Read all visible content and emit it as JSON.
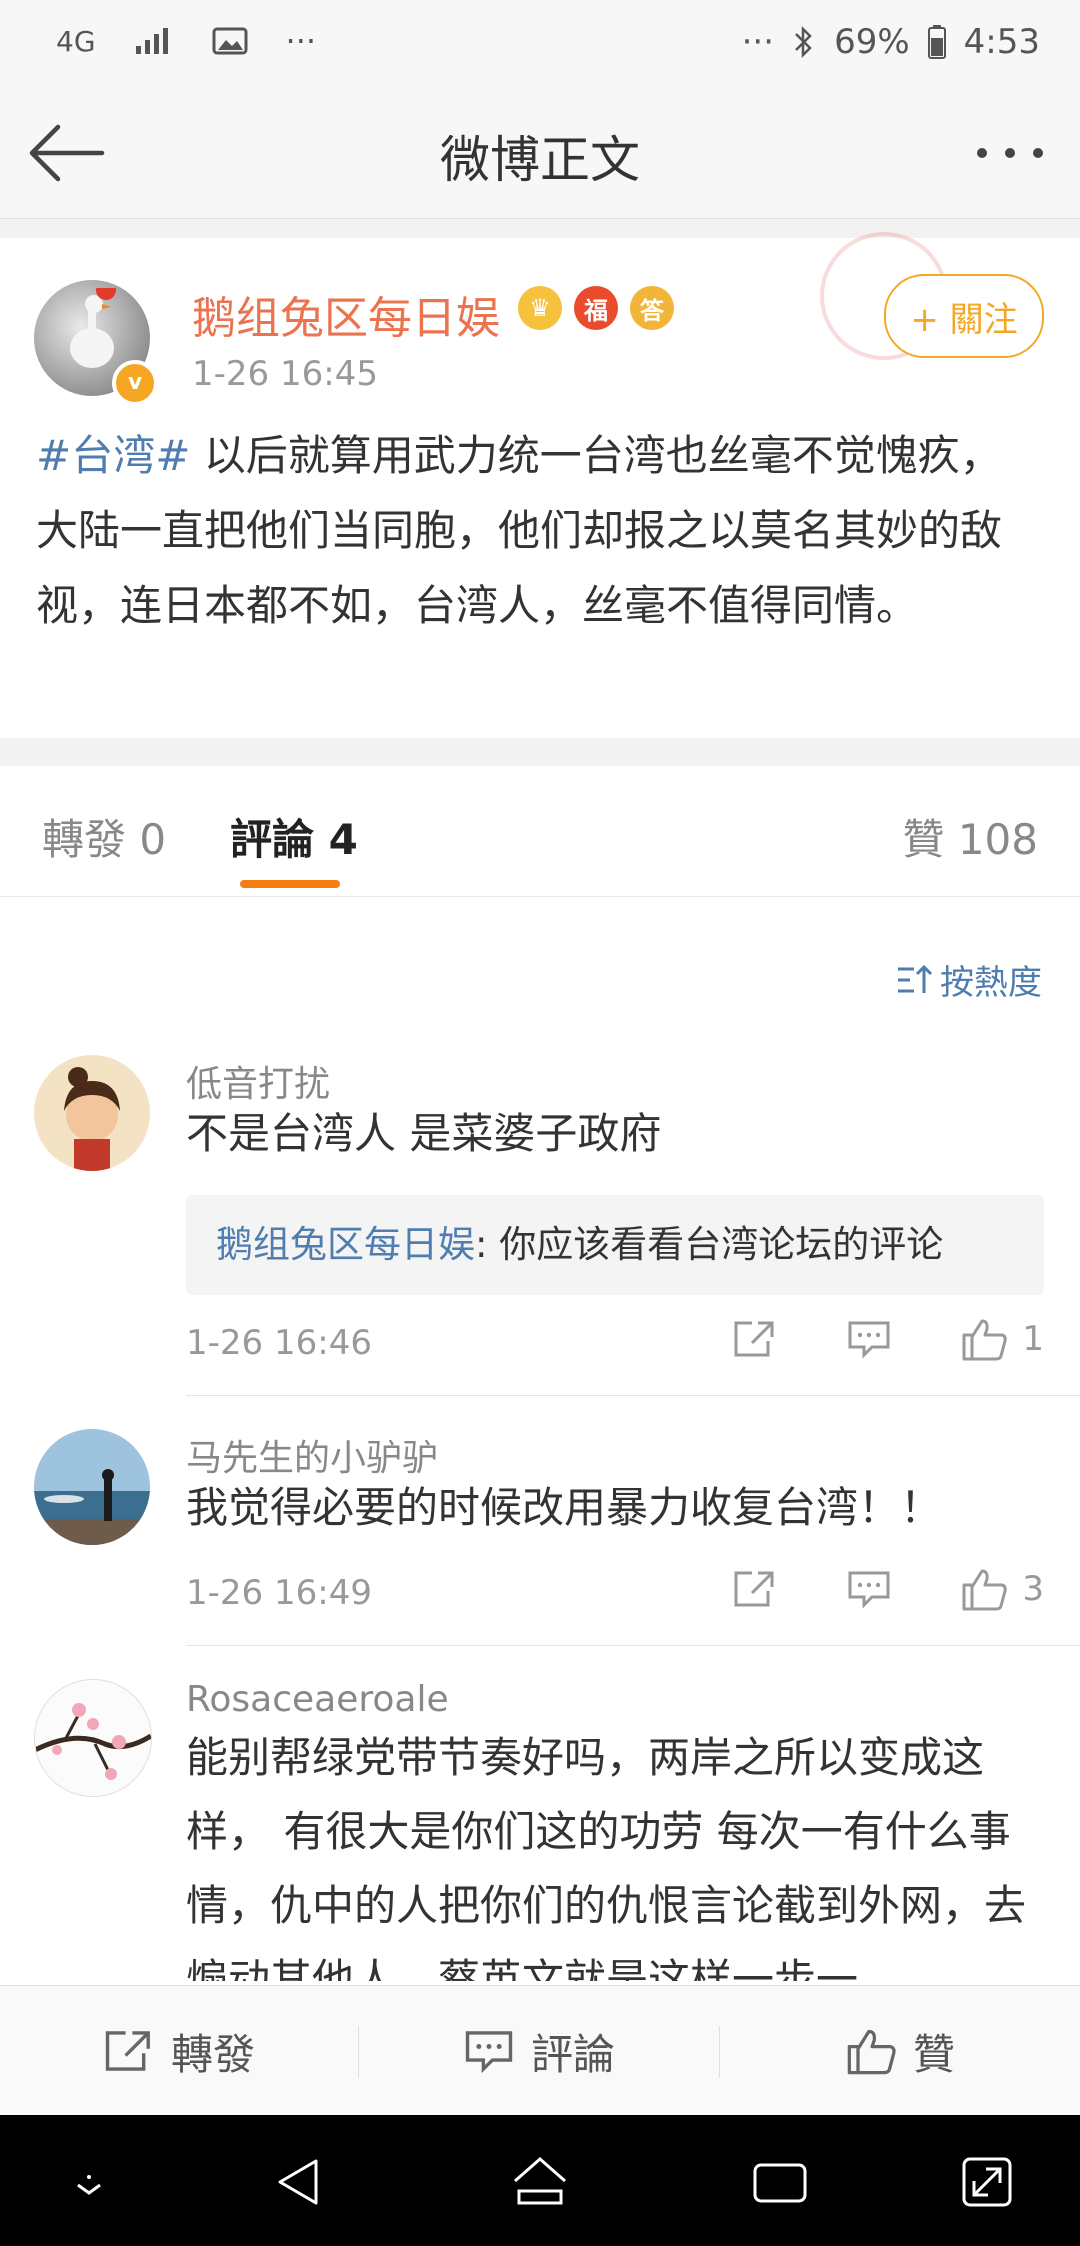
{
  "status_bar": {
    "network": "4G",
    "network_sub": "",
    "more": "···",
    "more_right": "···",
    "battery": "69%",
    "time": "4:53"
  },
  "nav": {
    "title": "微博正文"
  },
  "post": {
    "author": "鹅组兔区每日娱",
    "time": "1-26 16:45",
    "follow_label": "+ 關注",
    "badges": [
      "crown",
      "福",
      "答"
    ],
    "topic": "#台湾#",
    "text": " 以后就算用武力统一台湾也丝毫不觉愧疚，大陆一直把他们当同胞，他们却报之以莫名其妙的敌视，连日本都不如，台湾人，丝毫不值得同情。"
  },
  "tabs": {
    "repost": "轉發 0",
    "comment": "評論 4",
    "like": "贊 108"
  },
  "sort_label": "按熱度",
  "comments": [
    {
      "name": "低音打扰",
      "text": "不是台湾人 是菜婆子政府",
      "reply_name": "鹅组兔区每日娱",
      "reply_text": ": 你应该看看台湾论坛的评论",
      "time": "1-26 16:46",
      "likes": "1"
    },
    {
      "name": "马先生的小驴驴",
      "text": "我觉得必要的时候改用暴力收复台湾！！",
      "time": "1-26 16:49",
      "likes": "3"
    },
    {
      "name": "Rosaceaeroale",
      "text": "能别帮绿党带节奏好吗，两岸之所以变成这样， 有很大是你们这的功劳 每次一有什么事情，仇中的人把你们的仇恨言论截到外网，去煽动其他人，蔡英文就是这样一步一"
    }
  ],
  "toolbar": {
    "repost": "轉發",
    "comment": "評論",
    "like": "贊"
  },
  "colors": {
    "accent_orange": "#f57d12",
    "name_orange": "#eb7350",
    "link_blue": "#507daf",
    "follow_gold": "#f5a623"
  }
}
